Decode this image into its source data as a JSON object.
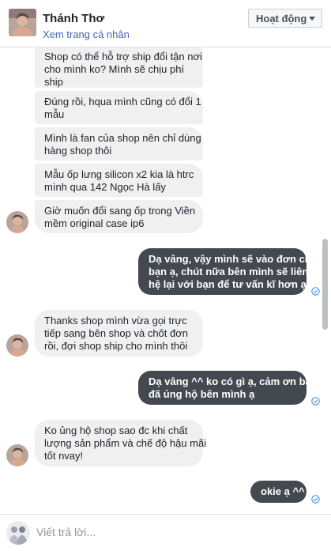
{
  "header": {
    "name": "Thánh Thơ",
    "profile_link": "Xem trang cá nhân",
    "status_button": "Hoạt động"
  },
  "messages": [
    {
      "from": "customer",
      "lines": [
        "Shop có thể hỗ trợ ship đổi tận nơi",
        "cho mình ko? Mình sẽ chịu phí",
        "ship"
      ]
    },
    {
      "from": "customer",
      "lines": [
        "Đúng rồi, hqua mình cũng có đổi 1",
        "mẫu"
      ]
    },
    {
      "from": "customer",
      "lines": [
        "Mình là fan của shop nên chỉ dùng",
        "hàng shop thôi"
      ]
    },
    {
      "from": "customer",
      "lines": [
        "Mẫu ốp lưng silicon x2 kia là htrc",
        "mình qua 142 Ngọc Hà lấy"
      ]
    },
    {
      "from": "customer",
      "lines": [
        "Giờ muốn đổi sang ốp trong Viền",
        "mềm original case ip6"
      ]
    },
    {
      "from": "shop",
      "lines": [
        "Dạ vâng, vậy mình sẽ vào đơn cho",
        "bạn ạ, chút nữa bên mình sẽ liên",
        "hệ lại với bạn để tư vấn kĩ hơn ạ"
      ]
    },
    {
      "from": "customer",
      "lines": [
        "Thanks shop mình vừa gọi trực",
        "tiếp sang bên shop và chốt đơn",
        "rồi, đợi shop ship cho mình thôi"
      ]
    },
    {
      "from": "shop",
      "lines": [
        "Dạ vâng ^^ ko có gì ạ, cảm ơn bạn",
        "đã ủng hộ bên mình ạ"
      ]
    },
    {
      "from": "customer",
      "lines": [
        "Ko ủng hộ shop sao đc khi chất",
        "lượng sản phẩm và chế độ hậu mãi",
        "tốt nvay!"
      ]
    },
    {
      "from": "shop",
      "lines": [
        "okie ạ ^^"
      ]
    }
  ],
  "composer": {
    "placeholder": "Viết trả lời..."
  },
  "colors": {
    "incoming_bubble": "#f1f0f0",
    "outgoing_bubble": "#444950",
    "link": "#4267b2",
    "seen_icon": "#4a90e2"
  },
  "icons": {
    "seen": "check-circle-icon",
    "status_caret": "chevron-down-icon"
  }
}
